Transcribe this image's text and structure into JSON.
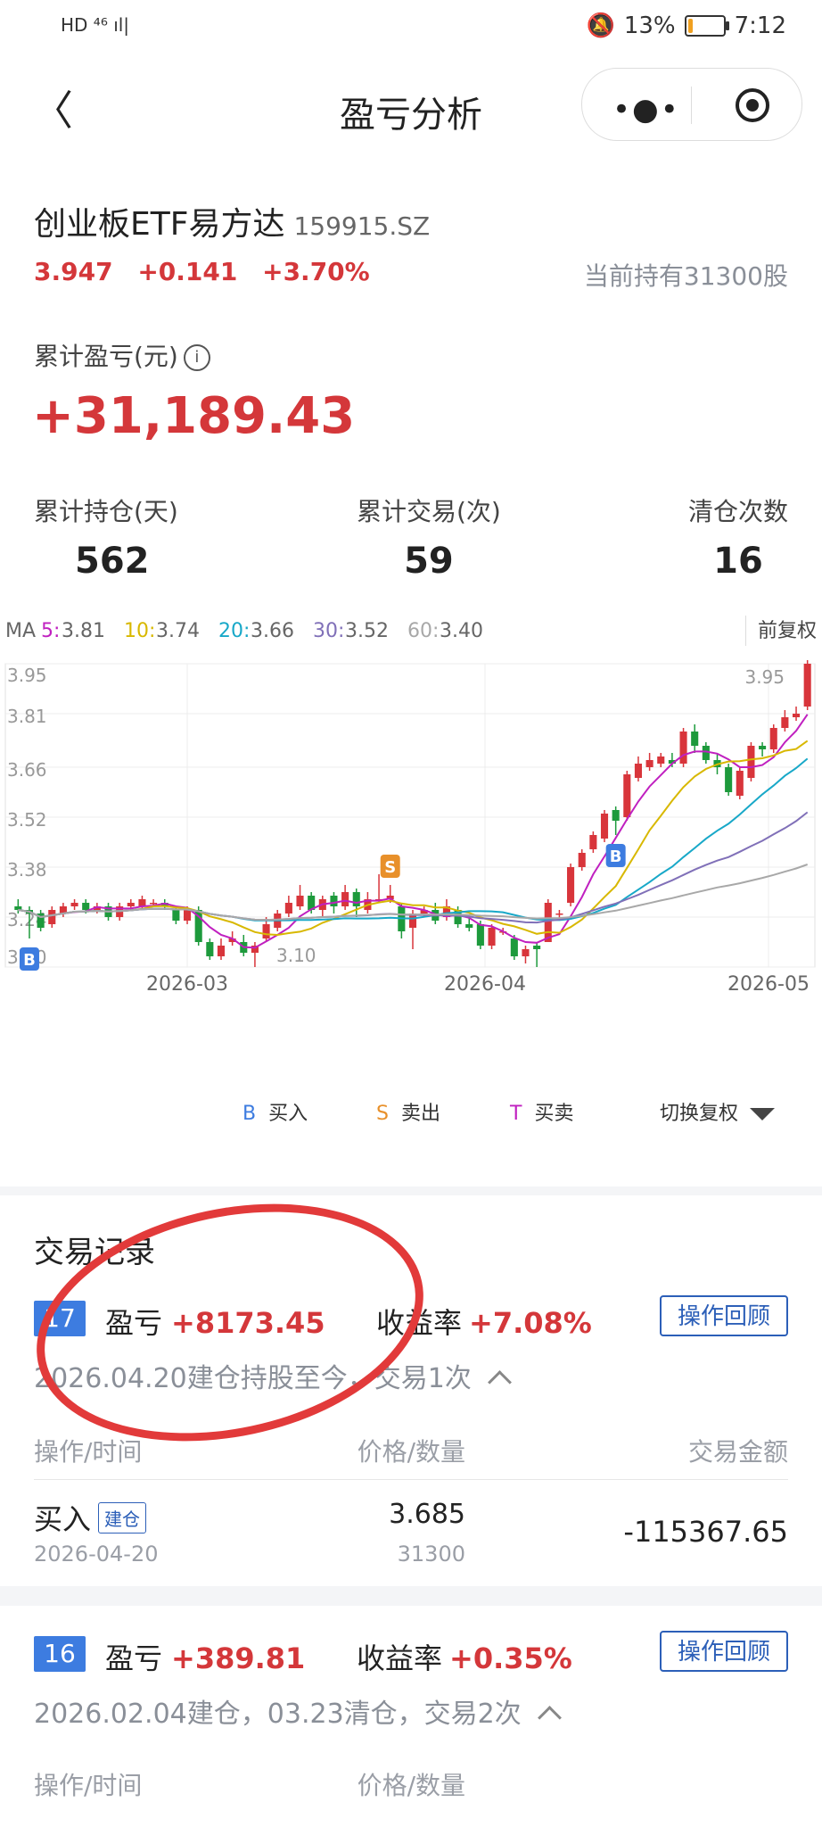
{
  "status_bar": {
    "network": "HD ⁴⁶ ıl|",
    "battery": "13%",
    "battery_level": 0.13,
    "time": "7:12"
  },
  "nav": {
    "title": "盈亏分析",
    "more": "•●•"
  },
  "stock": {
    "name": "创业板ETF易方达",
    "code": "159915.SZ",
    "price": "3.947",
    "change": "+0.141",
    "change_pct": "+3.70%",
    "holding": "当前持有31300股"
  },
  "summary": {
    "cum_pl_label": "累计盈亏(元)",
    "cum_pl_value": "+31,189.43",
    "stats": [
      {
        "label": "累计持仓(天)",
        "value": "562"
      },
      {
        "label": "累计交易(次)",
        "value": "59"
      },
      {
        "label": "清仓次数",
        "value": "16"
      }
    ]
  },
  "chart_data": {
    "type": "candlestick",
    "ma": {
      "label": "MA",
      "items": [
        {
          "name": "5",
          "value": "3.81",
          "color": "#c020c0"
        },
        {
          "name": "10",
          "value": "3.74",
          "color": "#d8b800"
        },
        {
          "name": "20",
          "value": "3.66",
          "color": "#18a8c8"
        },
        {
          "name": "30",
          "value": "3.52",
          "color": "#8070b8"
        },
        {
          "name": "60",
          "value": "3.40",
          "color": "#a8a8a8"
        }
      ]
    },
    "adjust_label": "前复权",
    "y_ticks": [
      "3.95",
      "3.81",
      "3.66",
      "3.52",
      "3.38",
      "3.24",
      "3.10"
    ],
    "ylim": [
      3.1,
      3.95
    ],
    "x_ticks": [
      "2026-03",
      "2026-04",
      "2026-05"
    ],
    "high_label": "3.95",
    "low_label": "3.10",
    "candles": [
      [
        3.27,
        3.26,
        3.29,
        3.25
      ],
      [
        3.26,
        3.25,
        3.27,
        3.18
      ],
      [
        3.25,
        3.21,
        3.26,
        3.2
      ],
      [
        3.22,
        3.26,
        3.27,
        3.21
      ],
      [
        3.25,
        3.27,
        3.28,
        3.24
      ],
      [
        3.27,
        3.28,
        3.29,
        3.26
      ],
      [
        3.28,
        3.26,
        3.29,
        3.25
      ],
      [
        3.26,
        3.27,
        3.28,
        3.25
      ],
      [
        3.27,
        3.24,
        3.28,
        3.23
      ],
      [
        3.24,
        3.27,
        3.28,
        3.23
      ],
      [
        3.27,
        3.28,
        3.29,
        3.26
      ],
      [
        3.27,
        3.29,
        3.3,
        3.26
      ],
      [
        3.28,
        3.28,
        3.29,
        3.27
      ],
      [
        3.28,
        3.27,
        3.29,
        3.26
      ],
      [
        3.26,
        3.23,
        3.27,
        3.22
      ],
      [
        3.23,
        3.26,
        3.27,
        3.22
      ],
      [
        3.26,
        3.17,
        3.27,
        3.16
      ],
      [
        3.17,
        3.13,
        3.18,
        3.12
      ],
      [
        3.13,
        3.16,
        3.18,
        3.12
      ],
      [
        3.17,
        3.18,
        3.2,
        3.16
      ],
      [
        3.17,
        3.14,
        3.19,
        3.13
      ],
      [
        3.14,
        3.16,
        3.17,
        3.1
      ],
      [
        3.18,
        3.22,
        3.24,
        3.17
      ],
      [
        3.21,
        3.25,
        3.26,
        3.2
      ],
      [
        3.25,
        3.28,
        3.3,
        3.24
      ],
      [
        3.27,
        3.3,
        3.33,
        3.26
      ],
      [
        3.3,
        3.26,
        3.31,
        3.25
      ],
      [
        3.26,
        3.29,
        3.3,
        3.24
      ],
      [
        3.3,
        3.27,
        3.31,
        3.25
      ],
      [
        3.27,
        3.31,
        3.33,
        3.26
      ],
      [
        3.31,
        3.27,
        3.32,
        3.24
      ],
      [
        3.26,
        3.29,
        3.31,
        3.25
      ],
      [
        3.29,
        3.29,
        3.36,
        3.28
      ],
      [
        3.29,
        3.3,
        3.33,
        3.28
      ],
      [
        3.27,
        3.2,
        3.28,
        3.18
      ],
      [
        3.21,
        3.25,
        3.26,
        3.15
      ],
      [
        3.25,
        3.26,
        3.27,
        3.24
      ],
      [
        3.26,
        3.23,
        3.28,
        3.22
      ],
      [
        3.24,
        3.27,
        3.29,
        3.23
      ],
      [
        3.26,
        3.22,
        3.27,
        3.21
      ],
      [
        3.22,
        3.21,
        3.24,
        3.2
      ],
      [
        3.22,
        3.16,
        3.23,
        3.15
      ],
      [
        3.16,
        3.21,
        3.22,
        3.15
      ],
      [
        3.2,
        3.2,
        3.21,
        3.19
      ],
      [
        3.18,
        3.13,
        3.19,
        3.12
      ],
      [
        3.13,
        3.15,
        3.16,
        3.11
      ],
      [
        3.16,
        3.15,
        3.17,
        3.1
      ],
      [
        3.17,
        3.28,
        3.29,
        3.17
      ],
      [
        3.25,
        3.25,
        3.26,
        3.23
      ],
      [
        3.28,
        3.38,
        3.39,
        3.27
      ],
      [
        3.38,
        3.42,
        3.43,
        3.37
      ],
      [
        3.43,
        3.47,
        3.48,
        3.42
      ],
      [
        3.46,
        3.53,
        3.54,
        3.45
      ],
      [
        3.54,
        3.51,
        3.55,
        3.47
      ],
      [
        3.52,
        3.64,
        3.65,
        3.51
      ],
      [
        3.63,
        3.67,
        3.69,
        3.62
      ],
      [
        3.66,
        3.68,
        3.7,
        3.65
      ],
      [
        3.67,
        3.69,
        3.7,
        3.66
      ],
      [
        3.68,
        3.67,
        3.7,
        3.66
      ],
      [
        3.67,
        3.76,
        3.77,
        3.66
      ],
      [
        3.76,
        3.72,
        3.78,
        3.7
      ],
      [
        3.72,
        3.68,
        3.73,
        3.67
      ],
      [
        3.68,
        3.66,
        3.7,
        3.64
      ],
      [
        3.66,
        3.59,
        3.67,
        3.58
      ],
      [
        3.58,
        3.65,
        3.66,
        3.57
      ],
      [
        3.63,
        3.72,
        3.73,
        3.62
      ],
      [
        3.72,
        3.71,
        3.73,
        3.69
      ],
      [
        3.71,
        3.77,
        3.78,
        3.7
      ],
      [
        3.77,
        3.8,
        3.82,
        3.76
      ],
      [
        3.8,
        3.81,
        3.83,
        3.79
      ],
      [
        3.83,
        3.95,
        3.96,
        3.82
      ]
    ]
  },
  "chart_legend": {
    "buy_mark": "B",
    "buy": "买入",
    "sell_mark": "S",
    "sell": "卖出",
    "trade_mark": "T",
    "trade": "买卖",
    "switch": "切换复权"
  },
  "trades": {
    "title": "交易记录",
    "header": {
      "op": "操作/时间",
      "price": "价格/数量",
      "amount": "交易金额"
    },
    "records": [
      {
        "index": "17",
        "pl_label": "盈亏",
        "pl_value": "+8173.45",
        "rate_label": "收益率",
        "rate_value": "+7.08%",
        "review": "操作回顾",
        "summary": "2026.04.20建仓持股至今，交易1次",
        "rows": [
          {
            "op": "买入",
            "tag": "建仓",
            "date": "2026-04-20",
            "price": "3.685",
            "qty": "31300",
            "amount": "-115367.65"
          }
        ]
      },
      {
        "index": "16",
        "pl_label": "盈亏",
        "pl_value": "+389.81",
        "rate_label": "收益率",
        "rate_value": "+0.35%",
        "review": "操作回顾",
        "summary": "2026.02.04建仓，03.23清仓，交易2次"
      }
    ]
  }
}
